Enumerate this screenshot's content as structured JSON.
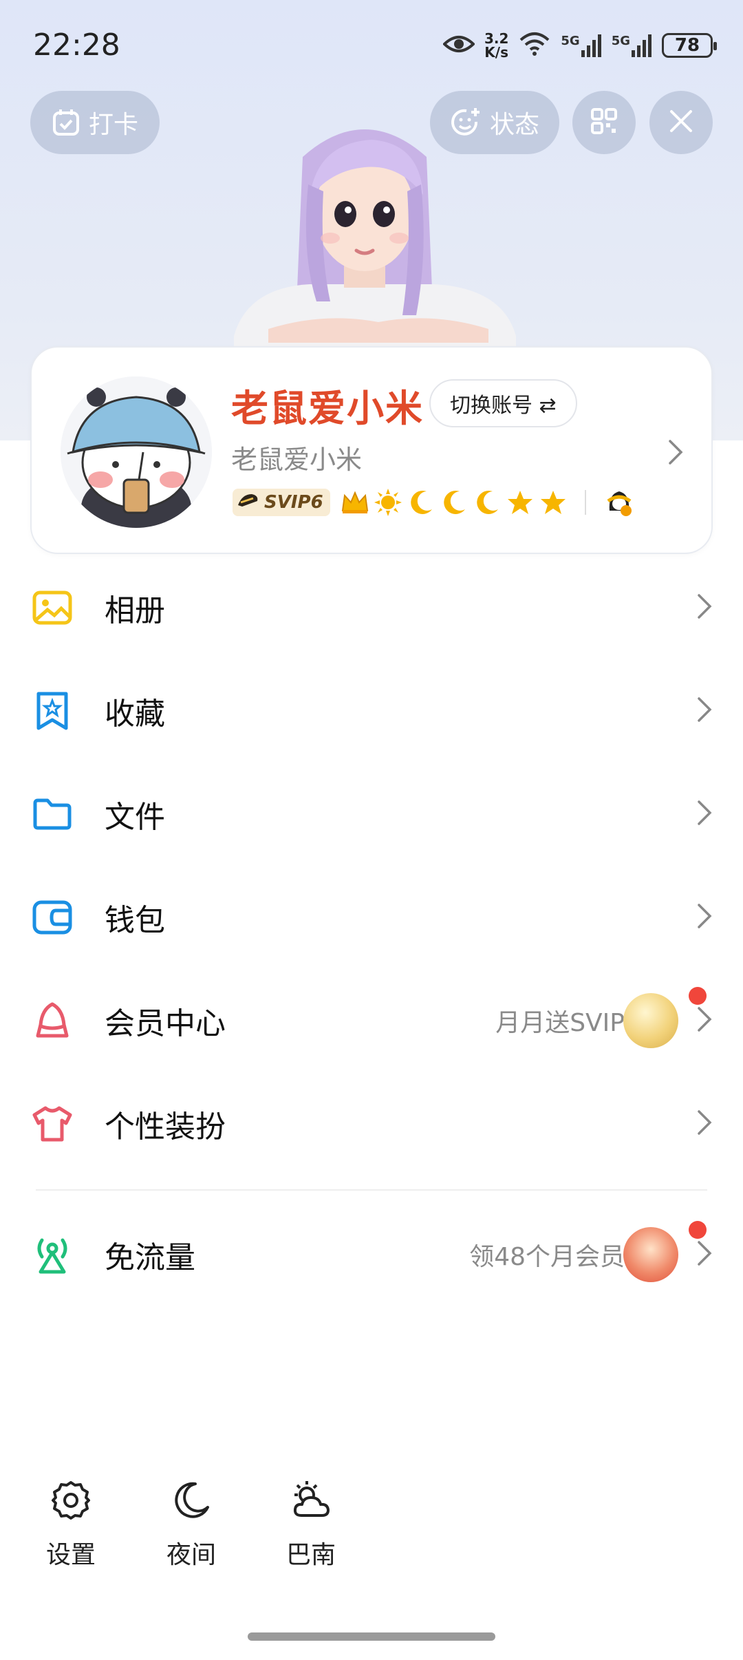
{
  "status_bar": {
    "time": "22:28",
    "net_speed_value": "3.2",
    "net_speed_unit": "K/s",
    "signal1_label": "5G",
    "signal2_label": "5G",
    "battery": "78"
  },
  "top_actions": {
    "checkin_label": "打卡",
    "status_label": "状态"
  },
  "profile": {
    "nickname": "老鼠爱小米",
    "switch_account_label": "切换账号 ⇄",
    "sub_name": "老鼠爱小米",
    "svip_label": "SVIP6",
    "level_icons": [
      "crown-icon",
      "sun-icon",
      "moon-icon",
      "moon-icon",
      "moon-icon",
      "star-icon",
      "star-icon"
    ]
  },
  "menu": [
    {
      "label": "相册",
      "icon": "album-icon",
      "icon_color": "#f5c518"
    },
    {
      "label": "收藏",
      "icon": "favorite-icon",
      "icon_color": "#1a8fe3"
    },
    {
      "label": "文件",
      "icon": "folder-icon",
      "icon_color": "#1a8fe3"
    },
    {
      "label": "钱包",
      "icon": "wallet-icon",
      "icon_color": "#1a8fe3"
    },
    {
      "label": "会员中心",
      "icon": "vip-icon",
      "icon_color": "#e85a6b",
      "extra": "月月送SVIP"
    },
    {
      "label": "个性装扮",
      "icon": "clothing-icon",
      "icon_color": "#e85a6b"
    },
    {
      "label": "免流量",
      "icon": "signal-tower-icon",
      "icon_color": "#1fbf7a",
      "extra": "领48个月会员"
    }
  ],
  "tools": [
    {
      "label": "设置",
      "icon": "gear-icon"
    },
    {
      "label": "夜间",
      "icon": "moon-icon"
    },
    {
      "label": "巴南",
      "icon": "weather-icon"
    }
  ],
  "colors": {
    "nickname": "#e04a2a",
    "notification_dot": "#f0463b"
  }
}
